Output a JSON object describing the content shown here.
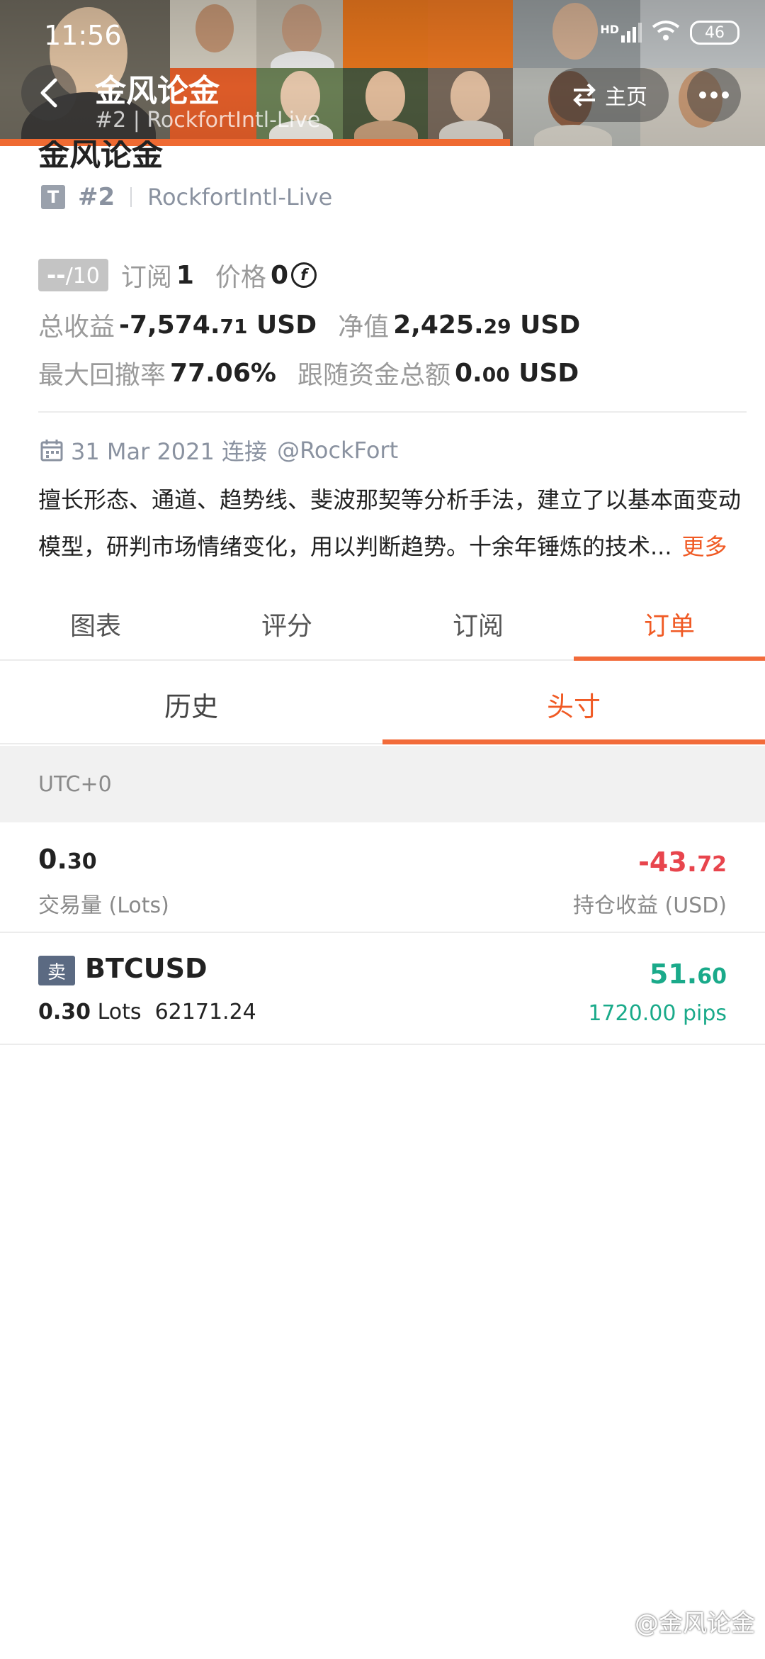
{
  "status_bar": {
    "time": "11:56",
    "signal_label": "HD",
    "battery": "46"
  },
  "nav": {
    "title": "金风论金",
    "subtitle": "#2 | RockfortIntl-Live",
    "home_label": "主页"
  },
  "profile": {
    "name": "金风论金",
    "badge": "T",
    "rank": "#2",
    "server": "RockfortIntl-Live",
    "rating": {
      "value": "--",
      "max": "/10"
    },
    "subscribe_label": "订阅",
    "subscribe_count": "1",
    "price_label": "价格",
    "price_value": "0",
    "total_profit_label": "总收益",
    "total_profit_main": "-7,574.",
    "total_profit_dec": "71",
    "total_profit_unit": "USD",
    "equity_label": "净值",
    "equity_main": "2,425.",
    "equity_dec": "29",
    "equity_unit": "USD",
    "max_drawdown_label": "最大回撤率",
    "max_drawdown_value": "77.06%",
    "follow_funds_label": "跟随资金总额",
    "follow_funds_main": "0.",
    "follow_funds_dec": "00",
    "follow_funds_unit": "USD",
    "connect_date": "31 Mar 2021 连接",
    "connect_user": "@RockFort",
    "description_line1": "擅长形态、通道、趋势线、斐波那契等分析手法，建立了以基本面变动",
    "description_line2": "模型，研判市场情绪变化，用以判断趋势。十余年锤炼的技术...",
    "more_label": "更多"
  },
  "tabs": [
    "图表",
    "评分",
    "订阅",
    "订单"
  ],
  "subtabs": [
    "历史",
    "头寸"
  ],
  "timezone": "UTC+0",
  "summary": {
    "lots_main": "0.",
    "lots_dec": "30",
    "lots_label": "交易量 (Lots)",
    "pl_main": "-43.",
    "pl_dec": "72",
    "pl_label": "持仓收益 (USD)"
  },
  "orders": [
    {
      "side": "卖",
      "symbol": "BTCUSD",
      "lots": "0.30",
      "lots_unit": "Lots",
      "price": "62171.24",
      "pl_main": "51.",
      "pl_dec": "60",
      "pips": "1720.00 pips"
    }
  ],
  "watermark": "@金风论金",
  "colors": {
    "accent": "#f05a24",
    "loss": "#e8454d",
    "profit": "#1aaa8a",
    "sell_badge": "#5b6a82"
  }
}
